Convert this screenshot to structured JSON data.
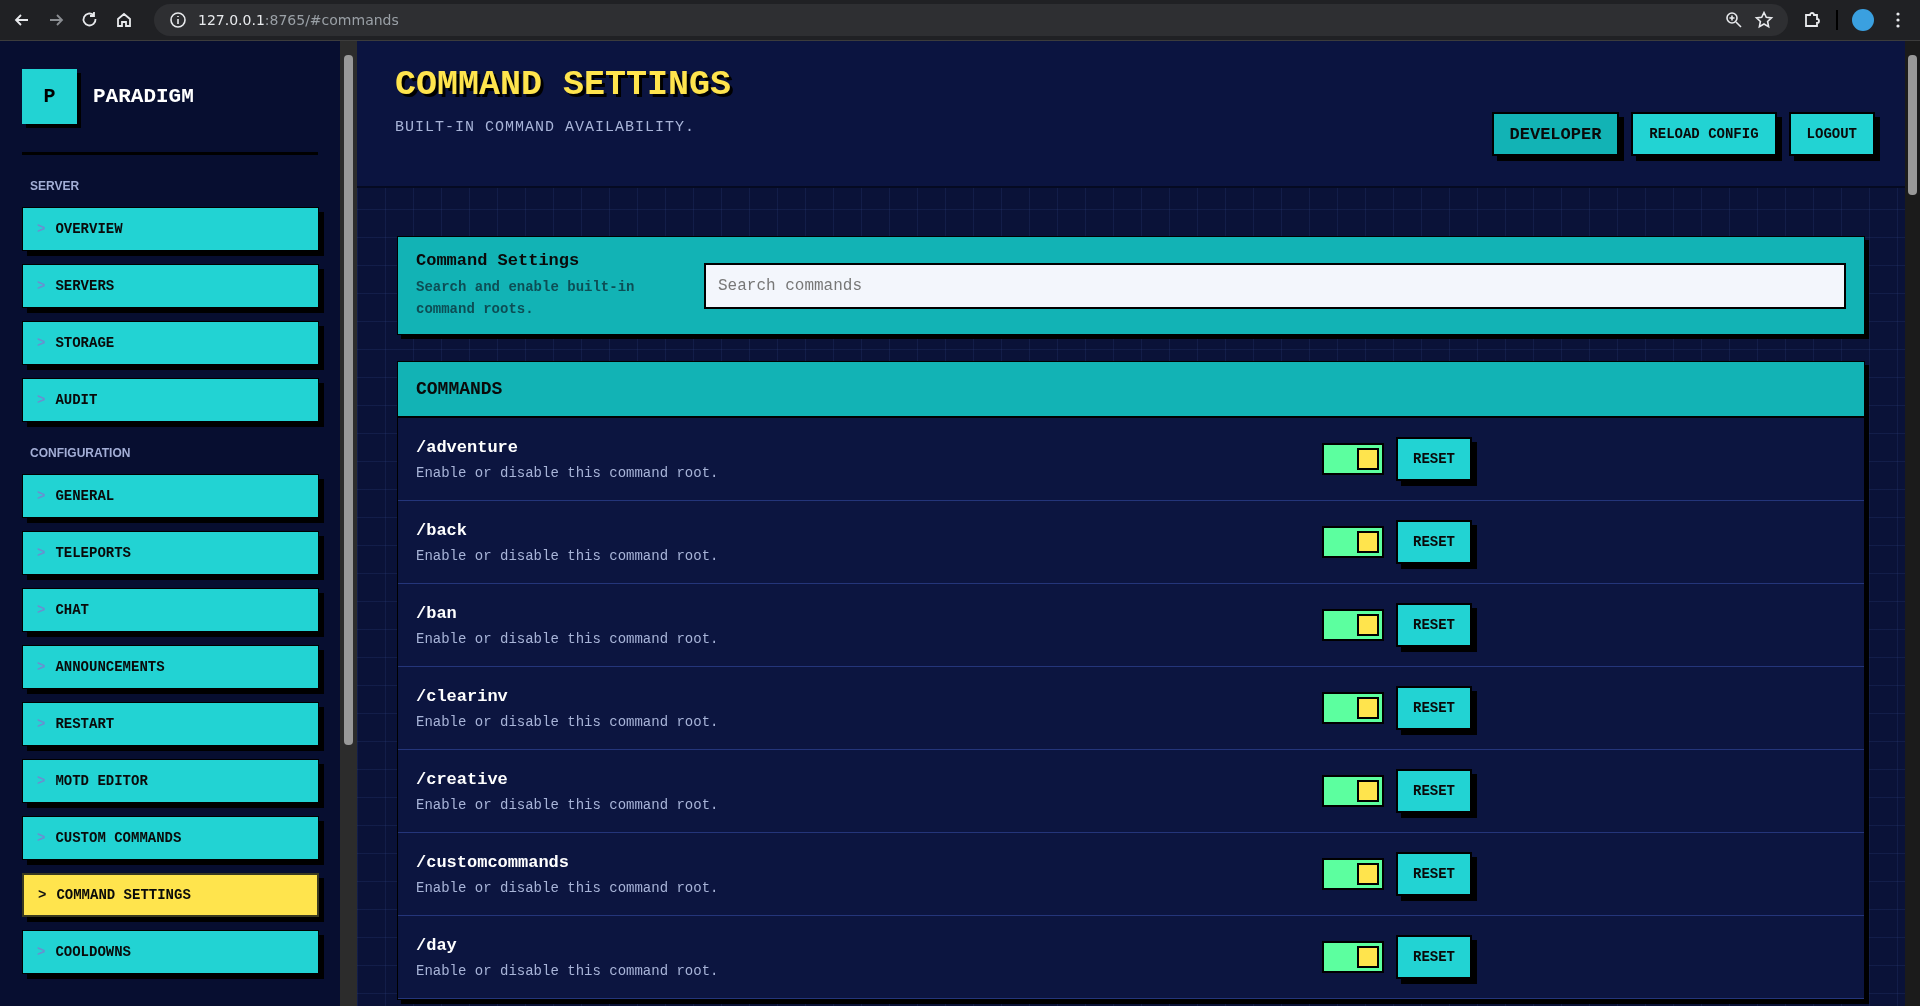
{
  "browser": {
    "url_host": "127.0.0.1",
    "url_rest": ":8765/#commands"
  },
  "sidebar": {
    "logo": "P",
    "brand": "PARADIGM",
    "sections": [
      {
        "title": "SERVER",
        "items": [
          {
            "prefix": ">",
            "label": "OVERVIEW",
            "selected": false
          },
          {
            "prefix": ">",
            "label": "SERVERS",
            "selected": false
          },
          {
            "prefix": ">",
            "label": "STORAGE",
            "selected": false
          },
          {
            "prefix": ">",
            "label": "AUDIT",
            "selected": false
          }
        ]
      },
      {
        "title": "CONFIGURATION",
        "items": [
          {
            "prefix": ">",
            "label": "GENERAL",
            "selected": false
          },
          {
            "prefix": ">",
            "label": "TELEPORTS",
            "selected": false
          },
          {
            "prefix": ">",
            "label": "CHAT",
            "selected": false
          },
          {
            "prefix": ">",
            "label": "ANNOUNCEMENTS",
            "selected": false
          },
          {
            "prefix": ">",
            "label": "RESTART",
            "selected": false
          },
          {
            "prefix": ">",
            "label": "MOTD EDITOR",
            "selected": false
          },
          {
            "prefix": ">",
            "label": "CUSTOM COMMANDS",
            "selected": false
          },
          {
            "prefix": ">",
            "label": "COMMAND SETTINGS",
            "selected": true
          },
          {
            "prefix": ">",
            "label": "COOLDOWNS",
            "selected": false
          }
        ]
      }
    ]
  },
  "header": {
    "title": "COMMAND SETTINGS",
    "subtitle": "BUILT-IN COMMAND AVAILABILITY.",
    "buttons": [
      {
        "label": "DEVELOPER",
        "selected": true
      },
      {
        "label": "RELOAD CONFIG",
        "selected": false
      },
      {
        "label": "LOGOUT",
        "selected": false
      }
    ]
  },
  "search_card": {
    "title": "Command Settings",
    "description": "Search and enable built-in command roots.",
    "placeholder": "Search commands"
  },
  "commands": {
    "title": "COMMANDS",
    "rows": [
      {
        "name": "/adventure",
        "description": "Enable or disable this command root.",
        "enabled": true,
        "button": "RESET"
      },
      {
        "name": "/back",
        "description": "Enable or disable this command root.",
        "enabled": true,
        "button": "RESET"
      },
      {
        "name": "/ban",
        "description": "Enable or disable this command root.",
        "enabled": true,
        "button": "RESET"
      },
      {
        "name": "/clearinv",
        "description": "Enable or disable this command root.",
        "enabled": true,
        "button": "RESET"
      },
      {
        "name": "/creative",
        "description": "Enable or disable this command root.",
        "enabled": true,
        "button": "RESET"
      },
      {
        "name": "/customcommands",
        "description": "Enable or disable this command root.",
        "enabled": true,
        "button": "RESET"
      },
      {
        "name": "/day",
        "description": "Enable or disable this command root.",
        "enabled": true,
        "button": "RESET"
      }
    ]
  }
}
